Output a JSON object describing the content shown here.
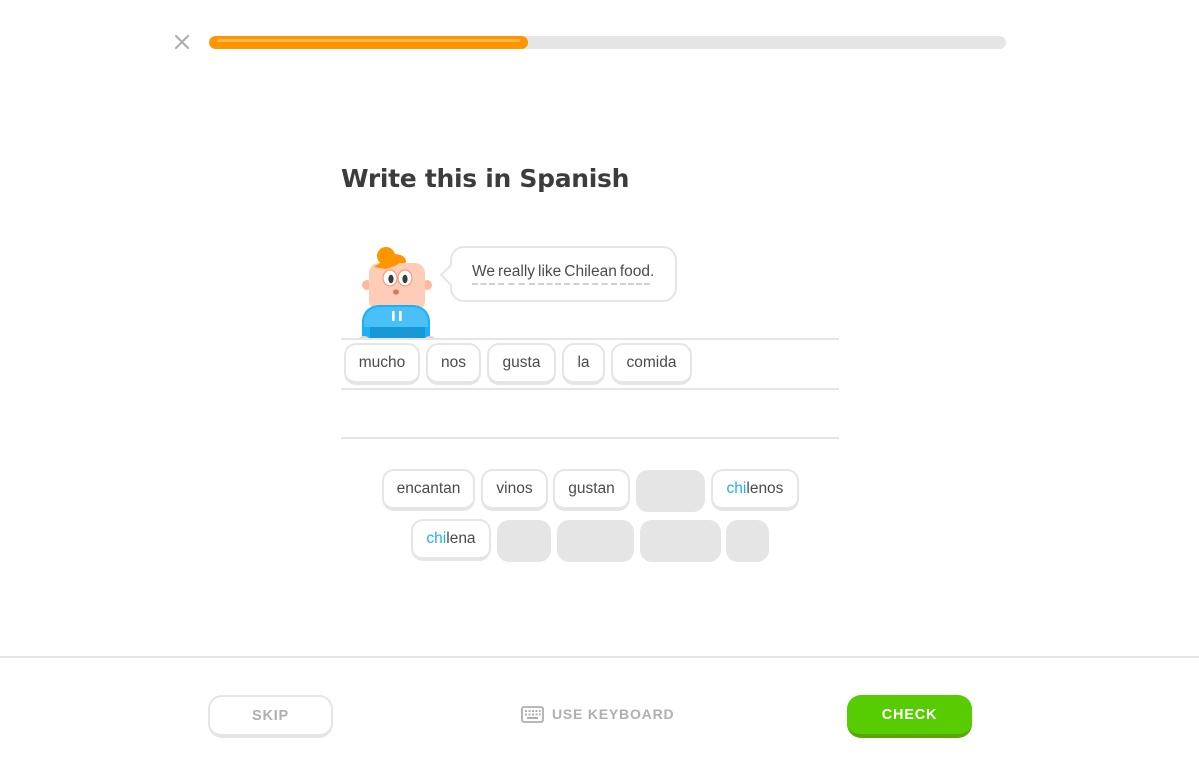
{
  "progress": {
    "value": 0.4,
    "fill_color": "#ff9600",
    "track_color": "#e5e5e5"
  },
  "close": {
    "icon": "close-icon"
  },
  "challenge": {
    "title": "Write this in Spanish"
  },
  "prompt": {
    "words": [
      "We",
      "really",
      "like",
      "Chilean",
      "food"
    ],
    "punctuation": "."
  },
  "answer_tokens": [
    "mucho",
    "nos",
    "gusta",
    "la",
    "comida"
  ],
  "word_bank": {
    "row1": [
      {
        "text": "encantan",
        "used": false
      },
      {
        "text": "vinos",
        "used": false
      },
      {
        "text": "gustan",
        "used": false
      },
      {
        "text": "",
        "used": true
      },
      {
        "highlight": "chi",
        "rest": "lenos",
        "used": false
      }
    ],
    "row2": [
      {
        "highlight": "chi",
        "rest": "lena",
        "used": false
      },
      {
        "text": "",
        "used": true
      },
      {
        "text": "",
        "used": true
      },
      {
        "text": "",
        "used": true
      },
      {
        "text": "",
        "used": true
      }
    ]
  },
  "footer": {
    "skip_label": "SKIP",
    "keyboard_label": "USE KEYBOARD",
    "check_label": "CHECK",
    "check_color": "#58cc02"
  }
}
